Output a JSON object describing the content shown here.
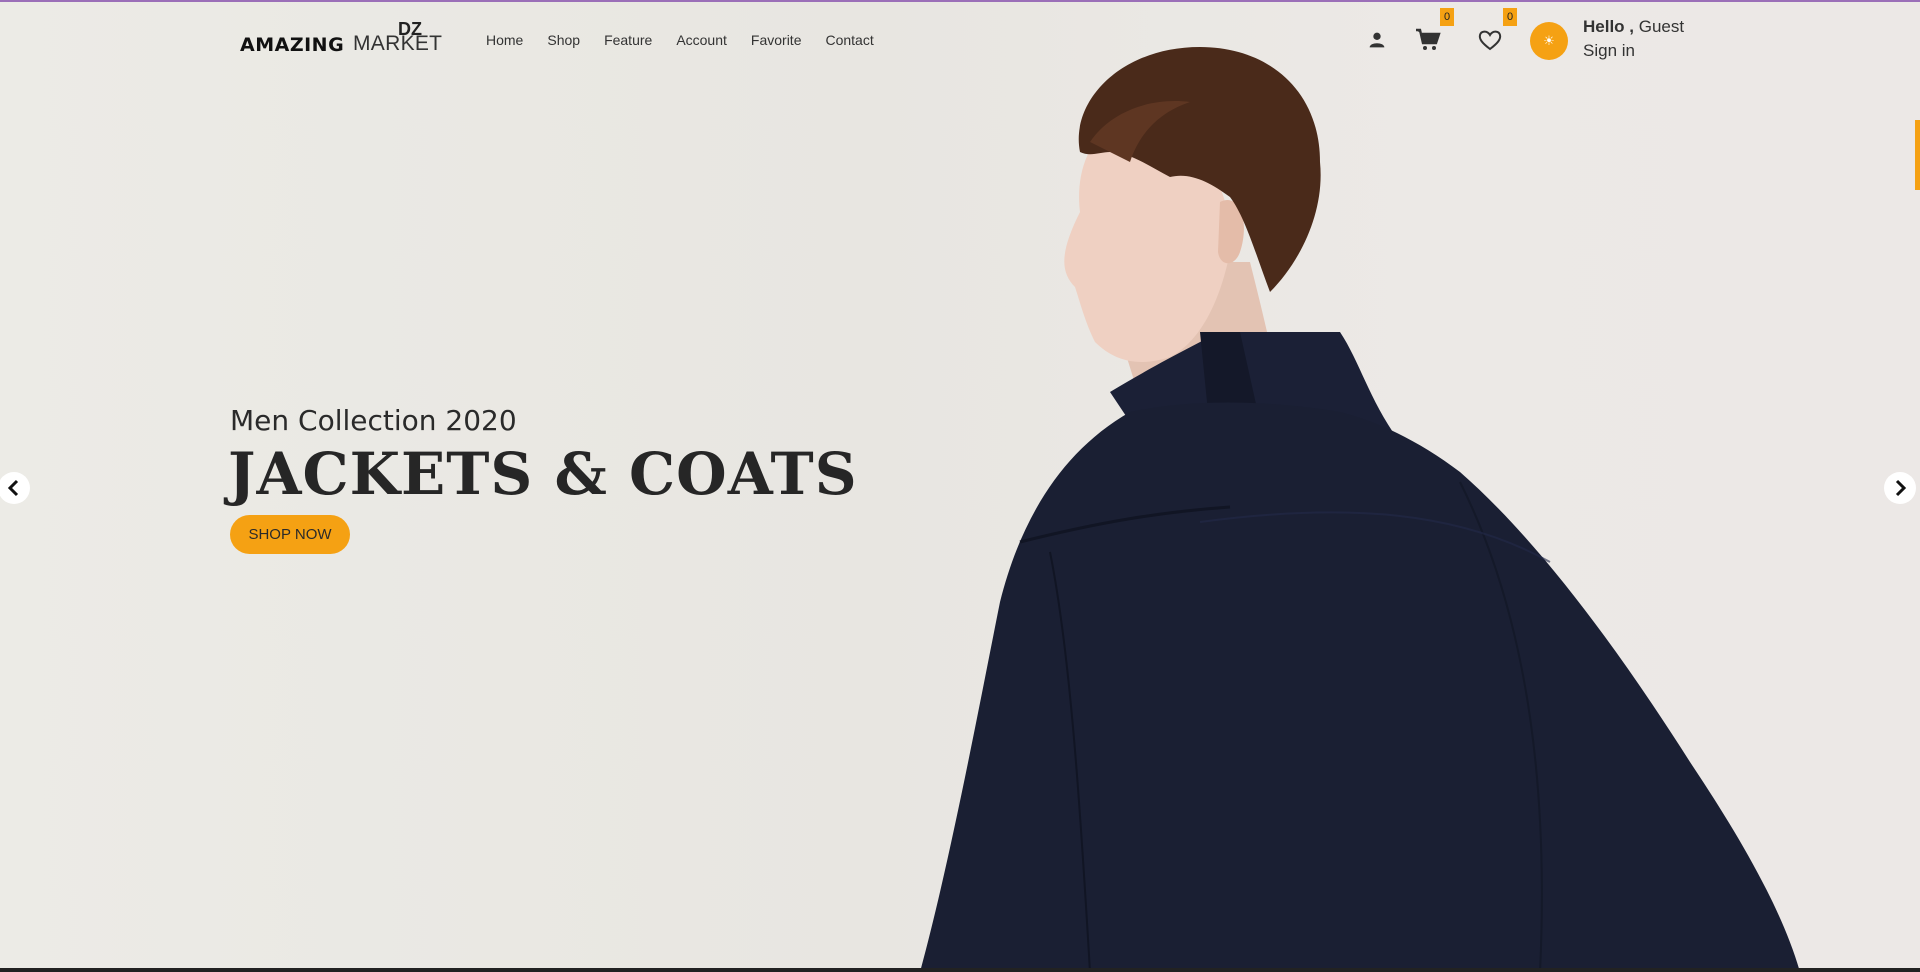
{
  "logo": {
    "primary": "AMAZING",
    "secondary": "MARKET",
    "superscript": "DZ"
  },
  "nav": {
    "items": [
      "Home",
      "Shop",
      "Feature",
      "Account",
      "Favorite",
      "Contact"
    ]
  },
  "header": {
    "cart_count": "0",
    "favorite_count": "0",
    "avatar_glyph": "☀",
    "greeting_hello": "Hello ,",
    "greeting_name": "Guest",
    "signin_label": "Sign in"
  },
  "hero": {
    "subtitle": "Men Collection 2020",
    "headline": "JACKETS & COATS",
    "cta_label": "SHOP NOW"
  },
  "icons": {
    "user": "user-icon",
    "cart": "cart-icon",
    "favorite": "heart-icon",
    "prev": "chevron-left-icon",
    "next": "chevron-right-icon"
  },
  "colors": {
    "accent": "#f5a113",
    "jacket": "#1a1f33",
    "text": "#262626"
  }
}
